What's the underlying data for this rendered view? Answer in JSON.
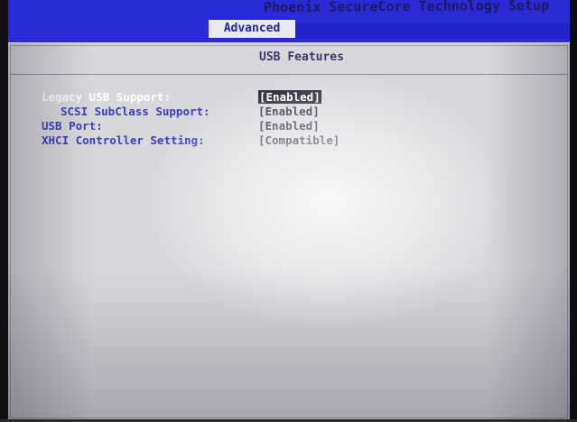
{
  "header": {
    "title": "Phoenix SecureCore Technology Setup"
  },
  "tabs": [
    {
      "label": "Advanced",
      "active": true
    }
  ],
  "panel": {
    "title": "USB Features"
  },
  "settings": [
    {
      "label": "Legacy USB Support:",
      "value": "[Enabled]",
      "selected": true,
      "indent": false
    },
    {
      "label": "SCSI SubClass Support:",
      "value": "[Enabled]",
      "selected": false,
      "indent": true
    },
    {
      "label": "USB Port:",
      "value": "[Enabled]",
      "selected": false,
      "indent": false
    },
    {
      "label": "XHCI Controller Setting:",
      "value": "[Compatible]",
      "selected": false,
      "indent": false
    }
  ],
  "colors": {
    "header_blue": "#2a2ad6",
    "panel_bg": "#d8d8dc",
    "label_blue": "#3c3cc8",
    "value_dark": "#26263a"
  }
}
